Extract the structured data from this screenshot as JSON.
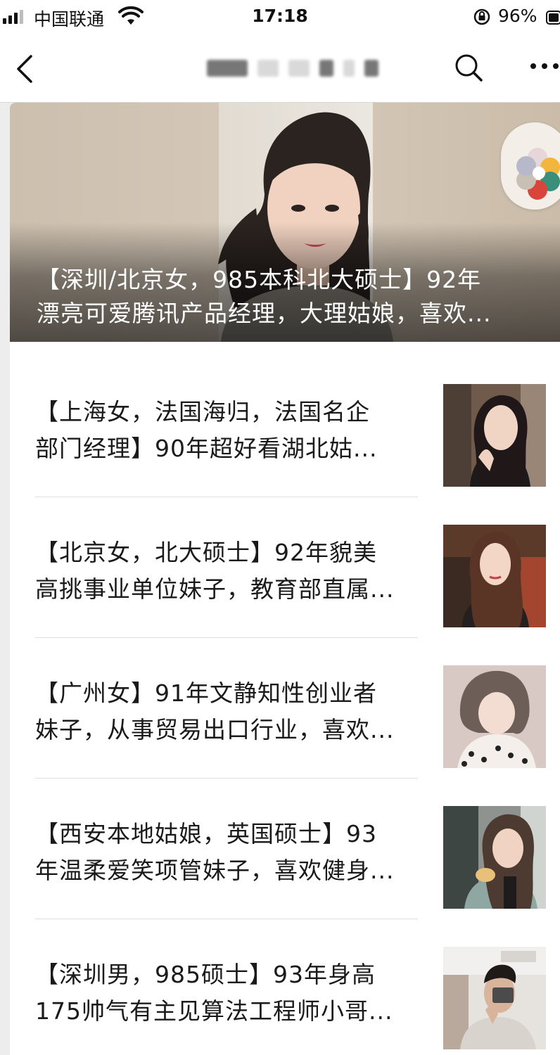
{
  "status_bar": {
    "carrier": "中国联通",
    "time": "17:18",
    "battery": "96%"
  },
  "nav": {
    "back_icon": "chevron-left-icon",
    "search_icon": "search-icon",
    "more_icon": "more-horizontal-icon"
  },
  "hero": {
    "title_line1": "【深圳/北京女，985本科北大硕士】92年",
    "title_line2": "漂亮可爱腾讯产品经理，大理姑娘，喜欢..."
  },
  "articles": [
    {
      "line1": "【上海女，法国海归，法国名企",
      "line2": "部门经理】90年超好看湖北姑..."
    },
    {
      "line1": "【北京女，北大硕士】92年貌美",
      "line2": "高挑事业单位妹子，教育部直属..."
    },
    {
      "line1": "【广州女】91年文静知性创业者",
      "line2": "妹子，从事贸易出口行业，喜欢..."
    },
    {
      "line1": "【西安本地姑娘，英国硕士】93",
      "line2": "年温柔爱笑项管妹子，喜欢健身..."
    },
    {
      "line1": "【深圳男，985硕士】93年身高",
      "line2": "175帅气有主见算法工程师小哥..."
    }
  ]
}
